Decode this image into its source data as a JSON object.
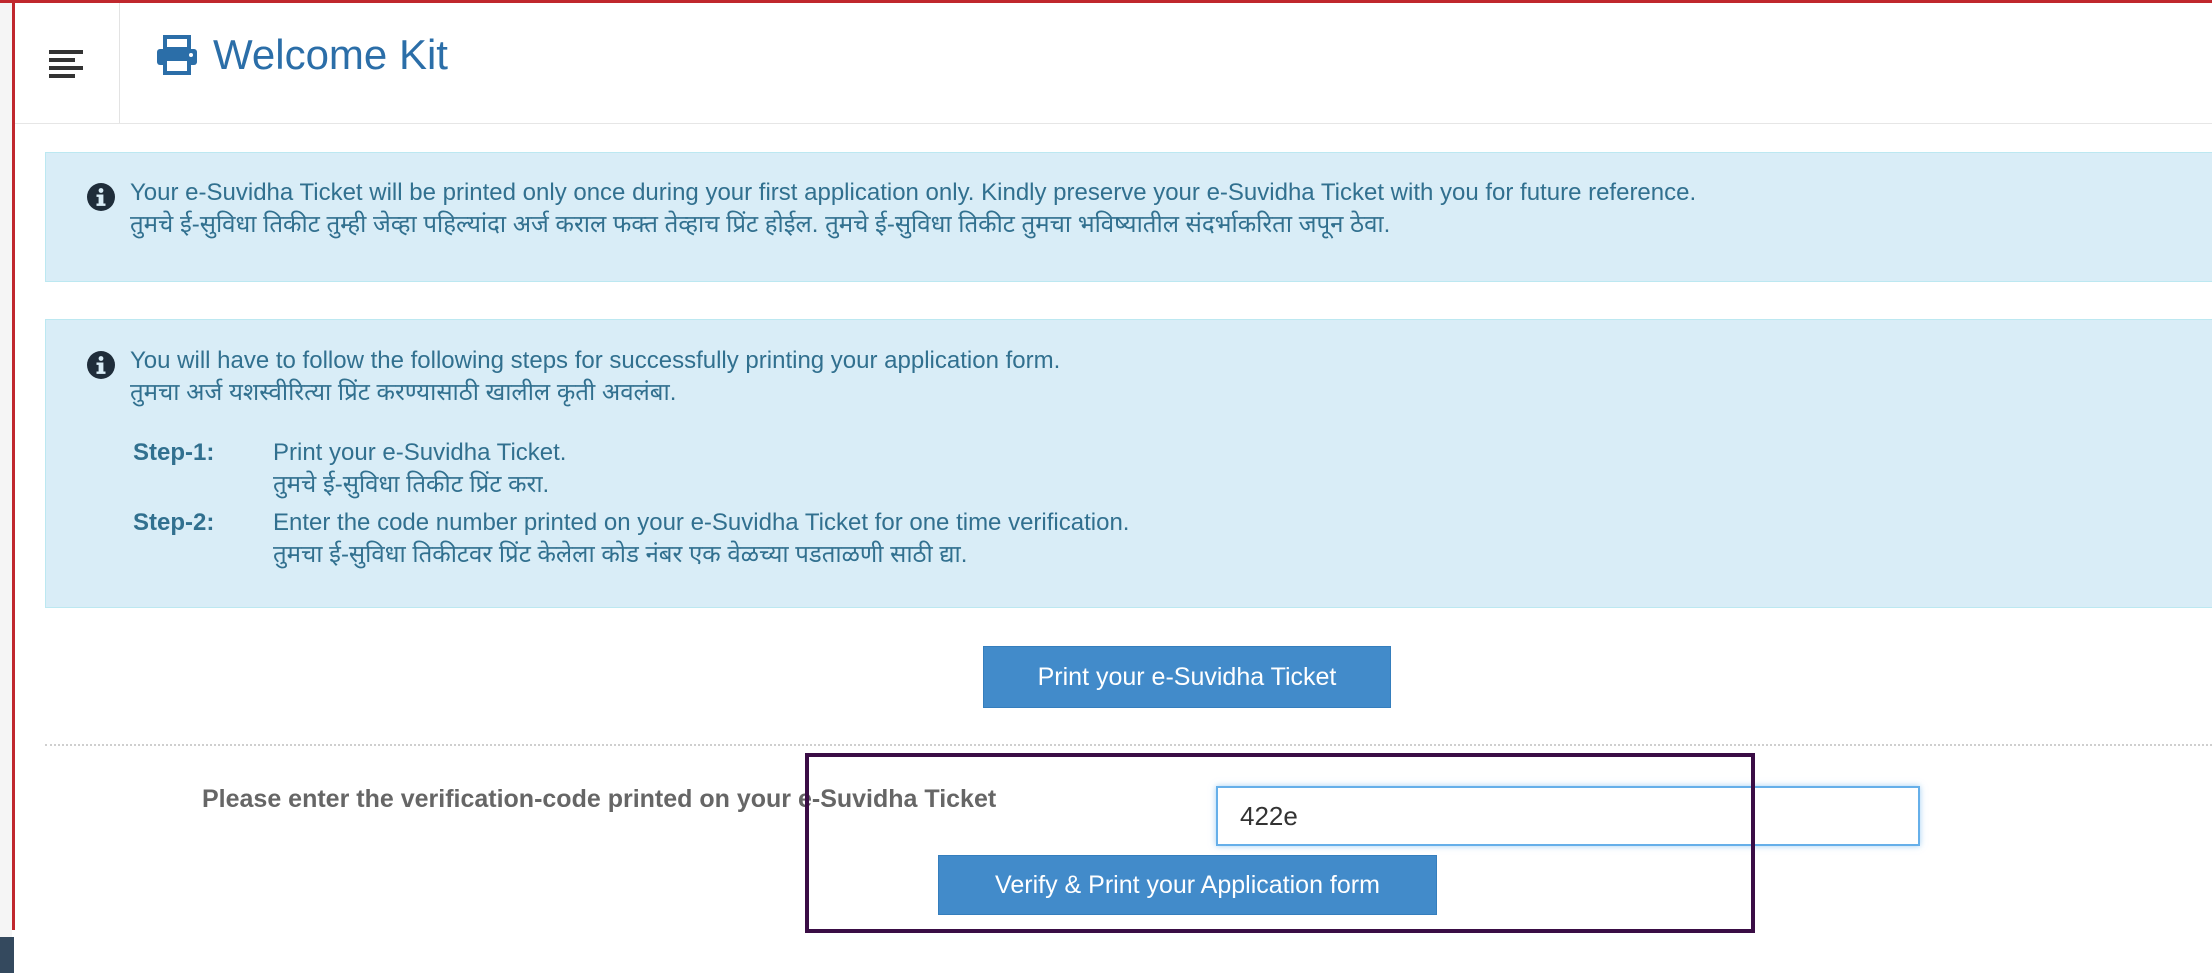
{
  "header": {
    "title": "Welcome Kit",
    "menu_icon": "hamburger-menu-icon",
    "title_icon": "printer-icon"
  },
  "notice": {
    "icon": "info-icon",
    "en": "Your e-Suvidha Ticket will be printed only once during your first application only. Kindly preserve your e-Suvidha Ticket with you for future reference.",
    "mr": "तुमचे ई-सुविधा तिकीट तुम्ही जेव्हा पहिल्यांदा अर्ज कराल फक्त तेव्हाच प्रिंट होईल. तुमचे ई-सुविधा तिकीट तुमचा भविष्यातील संदर्भाकरिता जपून ठेवा."
  },
  "steps_box": {
    "icon": "info-icon",
    "intro_en": "You will have to follow the following steps for successfully printing your application form.",
    "intro_mr": "तुमचा अर्ज यशस्वीरित्या प्रिंट करण्यासाठी खालील कृती अवलंबा.",
    "steps": [
      {
        "label": "Step-1:",
        "en": "Print your e-Suvidha Ticket.",
        "mr": "तुमचे ई-सुविधा तिकीट प्रिंट करा."
      },
      {
        "label": "Step-2:",
        "en": "Enter the code number printed on your e-Suvidha Ticket for one time verification.",
        "mr": "तुमचा ई-सुविधा तिकीटवर प्रिंट केलेला कोड नंबर एक वेळच्या पडताळणी साठी द्या."
      }
    ]
  },
  "actions": {
    "print_ticket_label": "Print your e-Suvidha Ticket",
    "verify_label": "Please enter the verification-code printed on your e-Suvidha Ticket",
    "code_value": "422e",
    "verify_button_label": "Verify & Print your Application form"
  },
  "colors": {
    "accent": "#428bca",
    "title": "#2b6ea8",
    "info_bg": "#d9edf7",
    "info_text": "#31708f",
    "highlight_border": "#3a0d45",
    "frame_red": "#c0272d"
  }
}
